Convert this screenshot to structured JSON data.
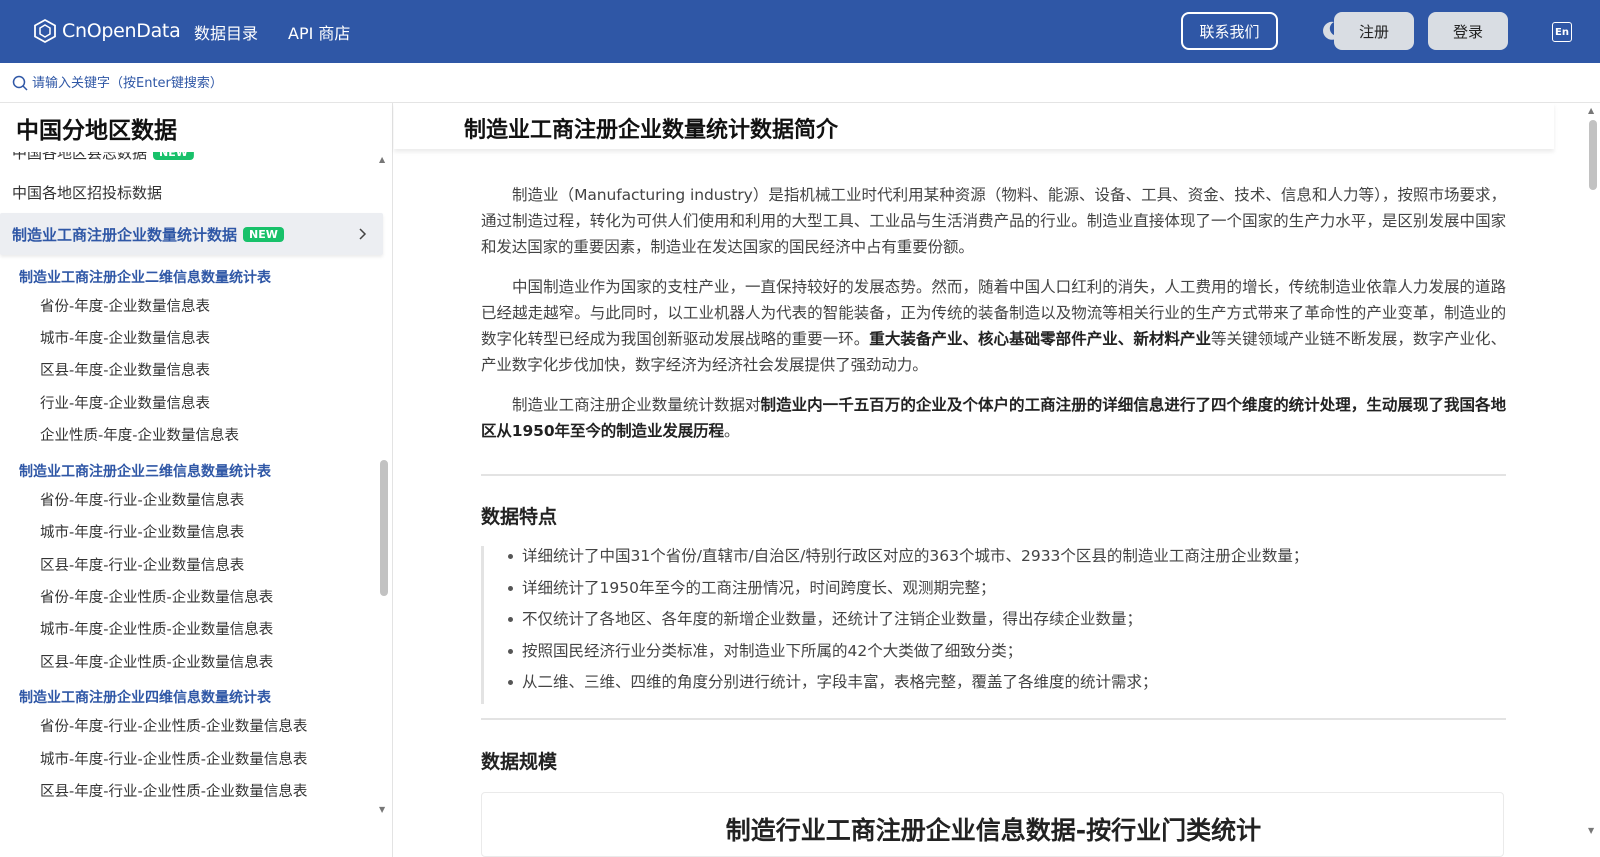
{
  "header": {
    "logo_text": "CnOpenData",
    "nav": [
      "数据目录",
      "API 商店"
    ],
    "contact_label": "联系我们",
    "register_label": "注册",
    "login_label": "登录",
    "lang_label": "En"
  },
  "search": {
    "placeholder": "请输入关键字（按Enter键搜索）"
  },
  "sidebar": {
    "title": "中国分地区数据",
    "items_before": [
      {
        "label": "中国各地区县志数据",
        "badge": "NEW"
      },
      {
        "label": "中国各地区招投标数据"
      }
    ],
    "active": {
      "label": "制造业工商注册企业数量统计数据",
      "badge": "NEW"
    },
    "groups": [
      {
        "title": "制造业工商注册企业二维信息数量统计表",
        "items": [
          "省份-年度-企业数量信息表",
          "城市-年度-企业数量信息表",
          "区县-年度-企业数量信息表",
          "行业-年度-企业数量信息表",
          "企业性质-年度-企业数量信息表"
        ]
      },
      {
        "title": "制造业工商注册企业三维信息数量统计表",
        "items": [
          "省份-年度-行业-企业数量信息表",
          "城市-年度-行业-企业数量信息表",
          "区县-年度-行业-企业数量信息表",
          "省份-年度-企业性质-企业数量信息表",
          "城市-年度-企业性质-企业数量信息表",
          "区县-年度-企业性质-企业数量信息表"
        ]
      },
      {
        "title": "制造业工商注册企业四维信息数量统计表",
        "items": [
          "省份-年度-行业-企业性质-企业数量信息表",
          "城市-年度-行业-企业性质-企业数量信息表",
          "区县-年度-行业-企业性质-企业数量信息表"
        ]
      }
    ]
  },
  "main": {
    "title": "制造业工商注册企业数量统计数据简介",
    "paragraphs": [
      {
        "text": "制造业（Manufacturing industry）是指机械工业时代利用某种资源（物料、能源、设备、工具、资金、技术、信息和人力等），按照市场要求，通过制造过程，转化为可供人们使用和利用的大型工具、工业品与生活消费产品的行业。制造业直接体现了一个国家的生产力水平，是区别发展中国家和发达国家的重要因素，制造业在发达国家的国民经济中占有重要份额。"
      },
      {
        "pre": "中国制造业作为国家的支柱产业，一直保持较好的发展态势。然而，随着中国人口红利的消失，人工费用的增长，传统制造业依靠人力发展的道路已经越走越窄。与此同时，以工业机器人为代表的智能装备，正为传统的装备制造以及物流等相关行业的生产方式带来了革命性的产业变革，制造业的数字化转型已经成为我国创新驱动发展战略的重要一环。",
        "bold": "重大装备产业、核心基础零部件产业、新材料产业",
        "post": "等关键领域产业链不断发展，数字产业化、产业数字化步伐加快，数字经济为经济社会发展提供了强劲动力。"
      },
      {
        "pre": "制造业工商注册企业数量统计数据对",
        "bold": "制造业内一千五百万的企业及个体户的工商注册的详细信息进行了四个维度的统计处理，生动展现了我国各地区从1950年至今的制造业发展历程",
        "post": "。"
      }
    ],
    "features_title": "数据特点",
    "features": [
      "详细统计了中国31个省份/直辖市/自治区/特别行政区对应的363个城市、2933个区县的制造业工商注册企业数量；",
      "详细统计了1950年至今的工商注册情况，时间跨度长、观测期完整；",
      "不仅统计了各地区、各年度的新增企业数量，还统计了注销企业数量，得出存续企业数量；",
      "按照国民经济行业分类标准，对制造业下所属的42个大类做了细致分类；",
      "从二维、三维、四维的角度分别进行统计，字段丰富，表格完整，覆盖了各维度的统计需求；"
    ],
    "scale_title": "数据规模",
    "card_title": "制造行业工商注册企业信息数据-按行业门类统计"
  },
  "colors": {
    "brand": "#2f57a6",
    "badge": "#18c16a"
  }
}
